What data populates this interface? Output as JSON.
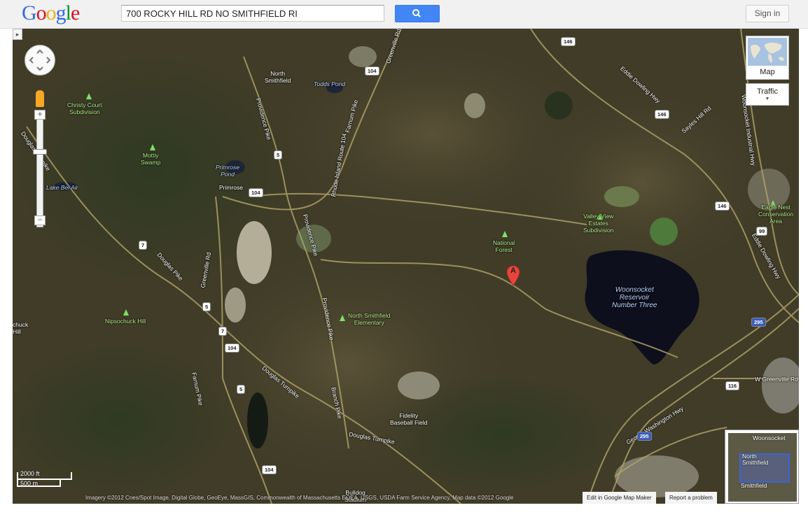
{
  "header": {
    "logo_letters": [
      {
        "ch": "G",
        "color": "#3369e8"
      },
      {
        "ch": "o",
        "color": "#d50f25"
      },
      {
        "ch": "o",
        "color": "#eeb211"
      },
      {
        "ch": "g",
        "color": "#3369e8"
      },
      {
        "ch": "l",
        "color": "#009925"
      },
      {
        "ch": "e",
        "color": "#d50f25"
      }
    ],
    "search_value": "700 ROCKY HILL RD NO SMITHFIELD RI",
    "search_icon": "magnifier-icon",
    "sign_in_label": "Sign in"
  },
  "map_controls": {
    "map_type_label": "Map",
    "traffic_label": "Traffic",
    "scale_imperial": "2000 ft",
    "scale_metric": "500 m"
  },
  "places": {
    "north_smithfield_town": "North\nSmithfield",
    "todds_pond": "Todds Pond",
    "christy_court": "Christy Court\nSubdivision",
    "mottiy_swamp": "Mottiy\nSwamp",
    "primrose_pond": "Primrose\nPond",
    "primrose": "Primrose",
    "lake_bel_air": "Lake Bel Air",
    "national_forest": "National\nForest",
    "valley_view": "Valley View\nEstates\nSubdivision",
    "eagle_nest": "Eagle Nest\nConservation\nArea",
    "woonsocket_reservoir": "Woonsocket\nReservoir\nNumber Three",
    "nipsochuck_hill": "Nipsochuck Hill",
    "ns_elementary": "North Smithfield\nElementary",
    "fidelity_field": "Fidelity\nBaseball Field",
    "bulldog_stadium": "Bulldog\nStadium",
    "chuck": "chuck\nHill"
  },
  "roads": {
    "greenville_rd": "Greenville Rd",
    "providence_pike": "Providence Pike",
    "farnum_pike": "Farnum Pike",
    "rhode_island_route_104": "Rhode Island Route 104",
    "douglas_turnpike": "Douglas Turnpike",
    "douglas_pike": "Douglas Pike",
    "greenville_rd2": "Greenville Rd",
    "providence_pike2": "Providence Pike",
    "branch_pike": "Branch Pike",
    "eddie_dowling_hwy": "Eddie Dowling Hwy",
    "sayles_hill_rd": "Sayles Hill Rd",
    "woonsocket_industrial_hwy": "Woonsocket Industrial Hwy",
    "eddie_dowling_hwy2": "Eddie Dowling Hwy",
    "george_washington_hwy": "George Washington Hwy",
    "w_greenville_rd": "W Greenville Rd",
    "douglas_turnpike2": "Douglas Turnpike"
  },
  "shields": [
    "146",
    "104",
    "146",
    "5",
    "104",
    "146",
    "99",
    "7",
    "5",
    "7",
    "104",
    "5",
    "104",
    "116",
    "295",
    "295"
  ],
  "marker": {
    "letter": "A",
    "color": "#e8453c"
  },
  "overview": {
    "woonsocket": "Woonsocket",
    "north_smithfield": "North\nSmithfield",
    "smithfield": "Smithfield"
  },
  "footer": {
    "attribution": "Imagery ©2012 Cnes/Spot Image, Digital Globe, GeoEye, MassGIS, Commonwealth of Massachusetts EOEA, USGS, USDA Farm Service Agency, Map data ©2012 Google",
    "edit_link": "Edit in Google Map Maker",
    "report_link": "Report a problem"
  }
}
